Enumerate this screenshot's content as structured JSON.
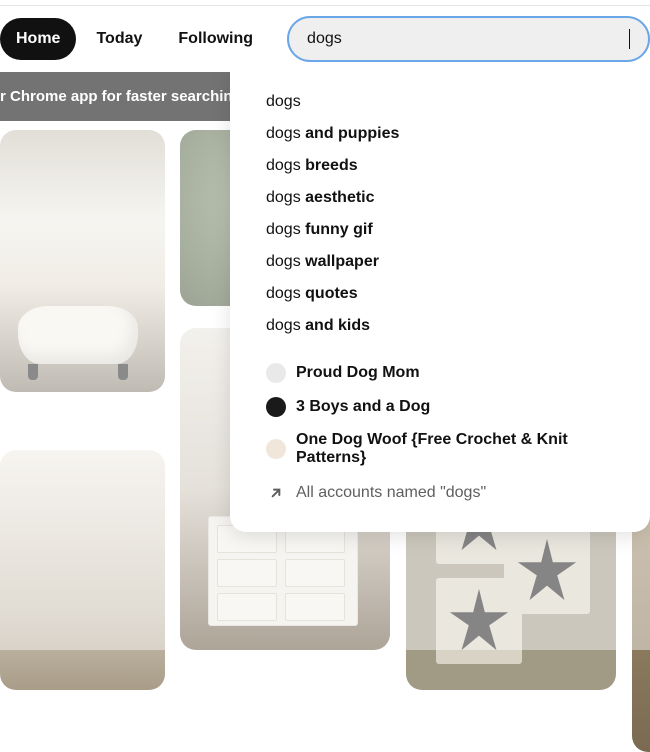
{
  "nav": {
    "home": "Home",
    "today": "Today",
    "following": "Following"
  },
  "search": {
    "value": "dogs"
  },
  "banner": {
    "text": "r Chrome app for faster searching"
  },
  "suggestions": [
    {
      "prefix": "dogs",
      "rest": ""
    },
    {
      "prefix": "dogs ",
      "rest": "and puppies"
    },
    {
      "prefix": "dogs ",
      "rest": "breeds"
    },
    {
      "prefix": "dogs ",
      "rest": "aesthetic"
    },
    {
      "prefix": "dogs ",
      "rest": "funny gif"
    },
    {
      "prefix": "dogs ",
      "rest": "wallpaper"
    },
    {
      "prefix": "dogs ",
      "rest": "quotes"
    },
    {
      "prefix": "dogs ",
      "rest": "and kids"
    }
  ],
  "accounts": [
    {
      "name": "Proud Dog Mom"
    },
    {
      "name": "3 Boys and a Dog"
    },
    {
      "name": "One Dog Woof {Free Crochet & Knit Patterns}"
    }
  ],
  "allAccountsLabel": "All accounts named \"dogs\""
}
